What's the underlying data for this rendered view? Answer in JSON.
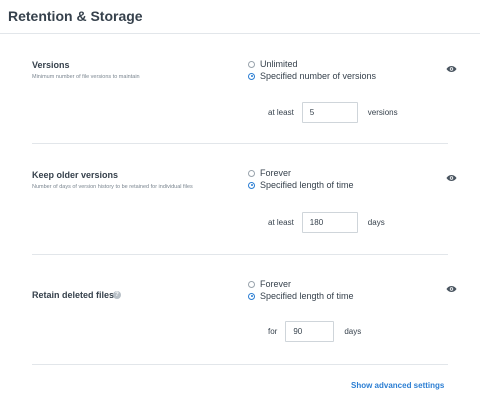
{
  "page": {
    "title": "Retention & Storage"
  },
  "sections": [
    {
      "title": "Versions",
      "description": "Minimum number of file versions to maintain",
      "options": [
        {
          "label": "Unlimited",
          "selected": false
        },
        {
          "label": "Specified number of versions",
          "selected": true
        }
      ],
      "field": {
        "prefix": "at least",
        "value": "5",
        "suffix": "versions"
      }
    },
    {
      "title": "Keep older versions",
      "description": "Number of days of version history to be retained for individual files",
      "options": [
        {
          "label": "Forever",
          "selected": false
        },
        {
          "label": "Specified length of time",
          "selected": true
        }
      ],
      "field": {
        "prefix": "at least",
        "value": "180",
        "suffix": "days"
      }
    },
    {
      "title": "Retain deleted files",
      "help_icon": "question-circle-icon",
      "options": [
        {
          "label": "Forever",
          "selected": false
        },
        {
          "label": "Specified length of time",
          "selected": true
        }
      ],
      "field": {
        "prefix": "for",
        "value": "90",
        "suffix": "days"
      }
    }
  ],
  "footer": {
    "advanced_link": "Show advanced settings"
  },
  "colors": {
    "accent": "#2b7ed3",
    "text": "#36414c",
    "muted": "#7b8690",
    "divider": "#e2e6ea"
  },
  "icons": {
    "visibility": "eye-icon",
    "help": "question-circle-icon"
  }
}
